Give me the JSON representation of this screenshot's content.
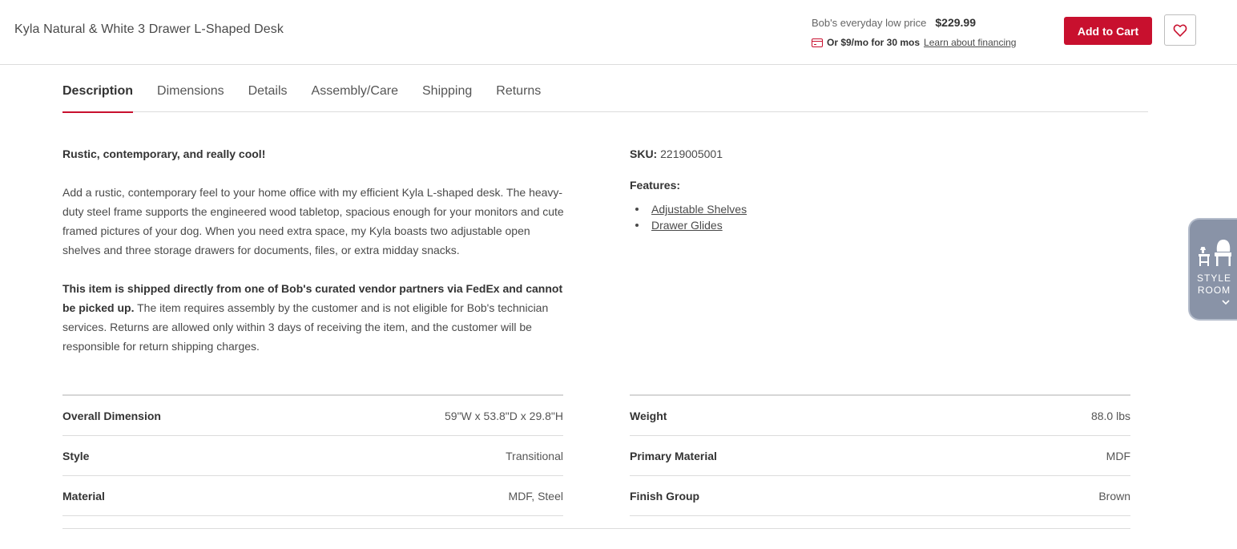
{
  "header": {
    "product_title": "Kyla Natural & White 3 Drawer L-Shaped Desk",
    "price_label": "Bob's everyday low price",
    "price": "$229.99",
    "financing_text": "Or $9/mo for 30 mos",
    "financing_link": "Learn about financing",
    "add_to_cart": "Add to Cart"
  },
  "tabs": [
    {
      "label": "Description",
      "active": true
    },
    {
      "label": "Dimensions"
    },
    {
      "label": "Details"
    },
    {
      "label": "Assembly/Care"
    },
    {
      "label": "Shipping"
    },
    {
      "label": "Returns"
    }
  ],
  "description": {
    "tagline": "Rustic, contemporary, and really cool!",
    "body": "Add a rustic, contemporary feel to your home office with my efficient Kyla L-shaped desk. The heavy-duty steel frame supports the engineered wood tabletop, spacious enough for your monitors and cute framed pictures of your dog. When you need extra space, my Kyla boasts two adjustable open shelves and three storage drawers for documents, files, or extra midday snacks.",
    "shipping_bold": "This item is shipped directly from one of Bob's curated vendor partners via FedEx and cannot be picked up.",
    "shipping_rest": " The item requires assembly by the customer and is not eligible for Bob's technician services. Returns are allowed only within 3 days of receiving the item, and the customer will be responsible for return shipping charges."
  },
  "sku": {
    "label": "SKU:",
    "value": "2219005001"
  },
  "features": {
    "title": "Features:",
    "items": [
      "Adjustable Shelves",
      "Drawer Glides"
    ]
  },
  "specs_left": [
    {
      "key": "Overall Dimension",
      "value": "59\"W x 53.8\"D x 29.8\"H"
    },
    {
      "key": "Style",
      "value": "Transitional"
    },
    {
      "key": "Material",
      "value": "MDF, Steel"
    }
  ],
  "specs_right": [
    {
      "key": "Weight",
      "value": "88.0 lbs"
    },
    {
      "key": "Primary Material",
      "value": "MDF"
    },
    {
      "key": "Finish Group",
      "value": "Brown"
    }
  ],
  "style_room": {
    "line1": "STYLE",
    "line2": "ROOM"
  },
  "colors": {
    "accent": "#c8102e",
    "style_room_bg": "#8993a7"
  },
  "icons": {
    "financing": "credit-card-icon",
    "wishlist": "heart-icon",
    "style_room": "furniture-icon",
    "style_room_toggle": "chevron-down-icon"
  }
}
